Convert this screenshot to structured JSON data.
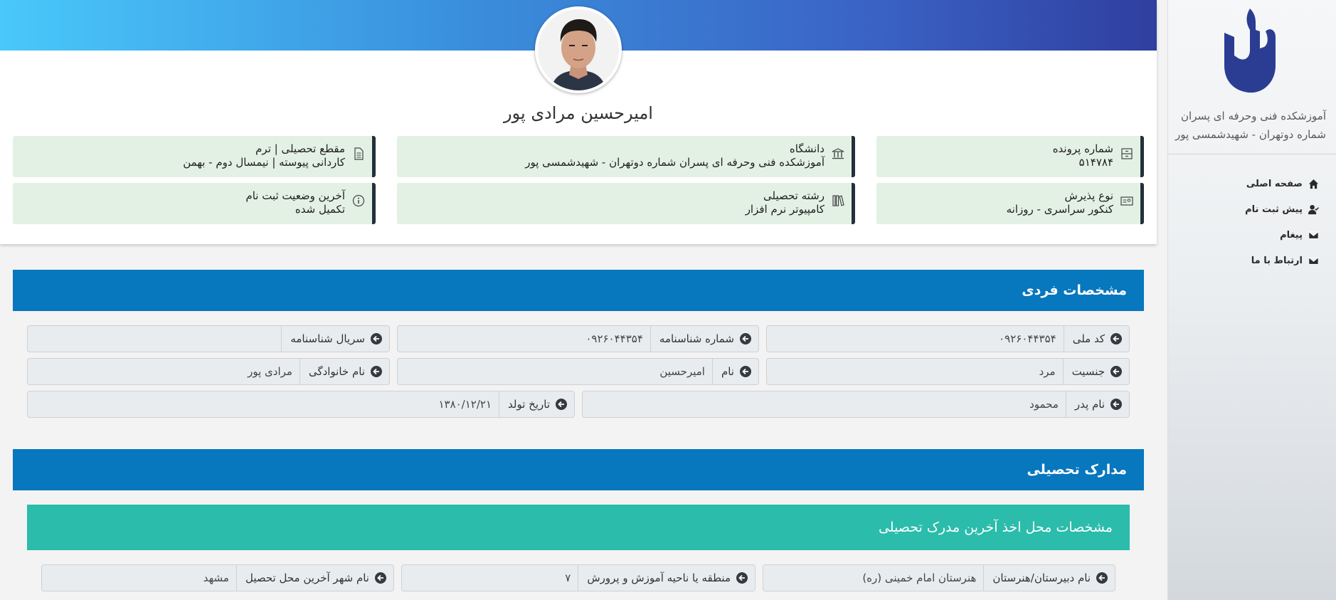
{
  "sidebar": {
    "school_name": "آموزشکده فنی وحرفه ای پسران شماره دوتهران - شهیدشمسی پور",
    "nav": [
      {
        "label": "صفحه اصلی",
        "icon": "home-icon"
      },
      {
        "label": "پیش ثبت نام",
        "icon": "user-check-icon"
      },
      {
        "label": "پیغام",
        "icon": "envelope-icon"
      },
      {
        "label": "ارتباط با ما",
        "icon": "envelope-icon"
      }
    ]
  },
  "profile": {
    "name": "امیرحسین مرادی پور",
    "boxes": [
      {
        "label": "شماره پرونده",
        "value": "۵۱۴۷۸۴",
        "icon": "file-cabinet-icon"
      },
      {
        "label": "دانشگاه",
        "value": "آموزشکده فنی وحرفه ای پسران شماره دوتهران - شهیدشمسی پور",
        "icon": "university-icon"
      },
      {
        "label": "مقطع تحصیلی | ترم",
        "value": "کاردانی پیوسته | نیمسال دوم - بهمن",
        "icon": "document-icon"
      },
      {
        "label": "نوع پذیرش",
        "value": "کنکور سراسری - روزانه",
        "icon": "id-card-icon"
      },
      {
        "label": "رشته تحصیلی",
        "value": "کامپیوتر نرم افزار",
        "icon": "books-icon"
      },
      {
        "label": "آخرین وضعیت ثبت نام",
        "value": "تکمیل شده",
        "icon": "info-icon"
      }
    ]
  },
  "personal": {
    "title": "مشخصات فردی",
    "fields": [
      {
        "label": "کد ملی",
        "value": "۰۹۲۶۰۴۴۳۵۴"
      },
      {
        "label": "شماره شناسنامه",
        "value": "۰۹۲۶۰۴۴۳۵۴"
      },
      {
        "label": "سریال شناسنامه",
        "value": ""
      },
      {
        "label": "جنسیت",
        "value": "مرد"
      },
      {
        "label": "نام",
        "value": "امیرحسین"
      },
      {
        "label": "نام خانوادگی",
        "value": "مرادی پور"
      },
      {
        "label": "نام پدر",
        "value": "محمود"
      },
      {
        "label": "تاریخ تولد",
        "value": "۱۳۸۰/۱۲/۲۱"
      }
    ]
  },
  "education": {
    "title": "مدارک تحصیلی",
    "subtitle": "مشخصات محل اخذ آخرین مدرک تحصیلی",
    "fields": [
      {
        "label": "نام دبیرستان/هنرستان",
        "value": "هنرستان امام خمینی (ره)"
      },
      {
        "label": "منطقه یا ناحیه آموزش و پرورش",
        "value": "۷"
      },
      {
        "label": "نام شهر آخرین محل تحصیل",
        "value": "مشهد"
      }
    ]
  },
  "colors": {
    "section_header": "#0777be",
    "subsection_header": "#2bbcab",
    "info_box_bg": "#e3f1e4",
    "logo": "#2a3d93"
  }
}
